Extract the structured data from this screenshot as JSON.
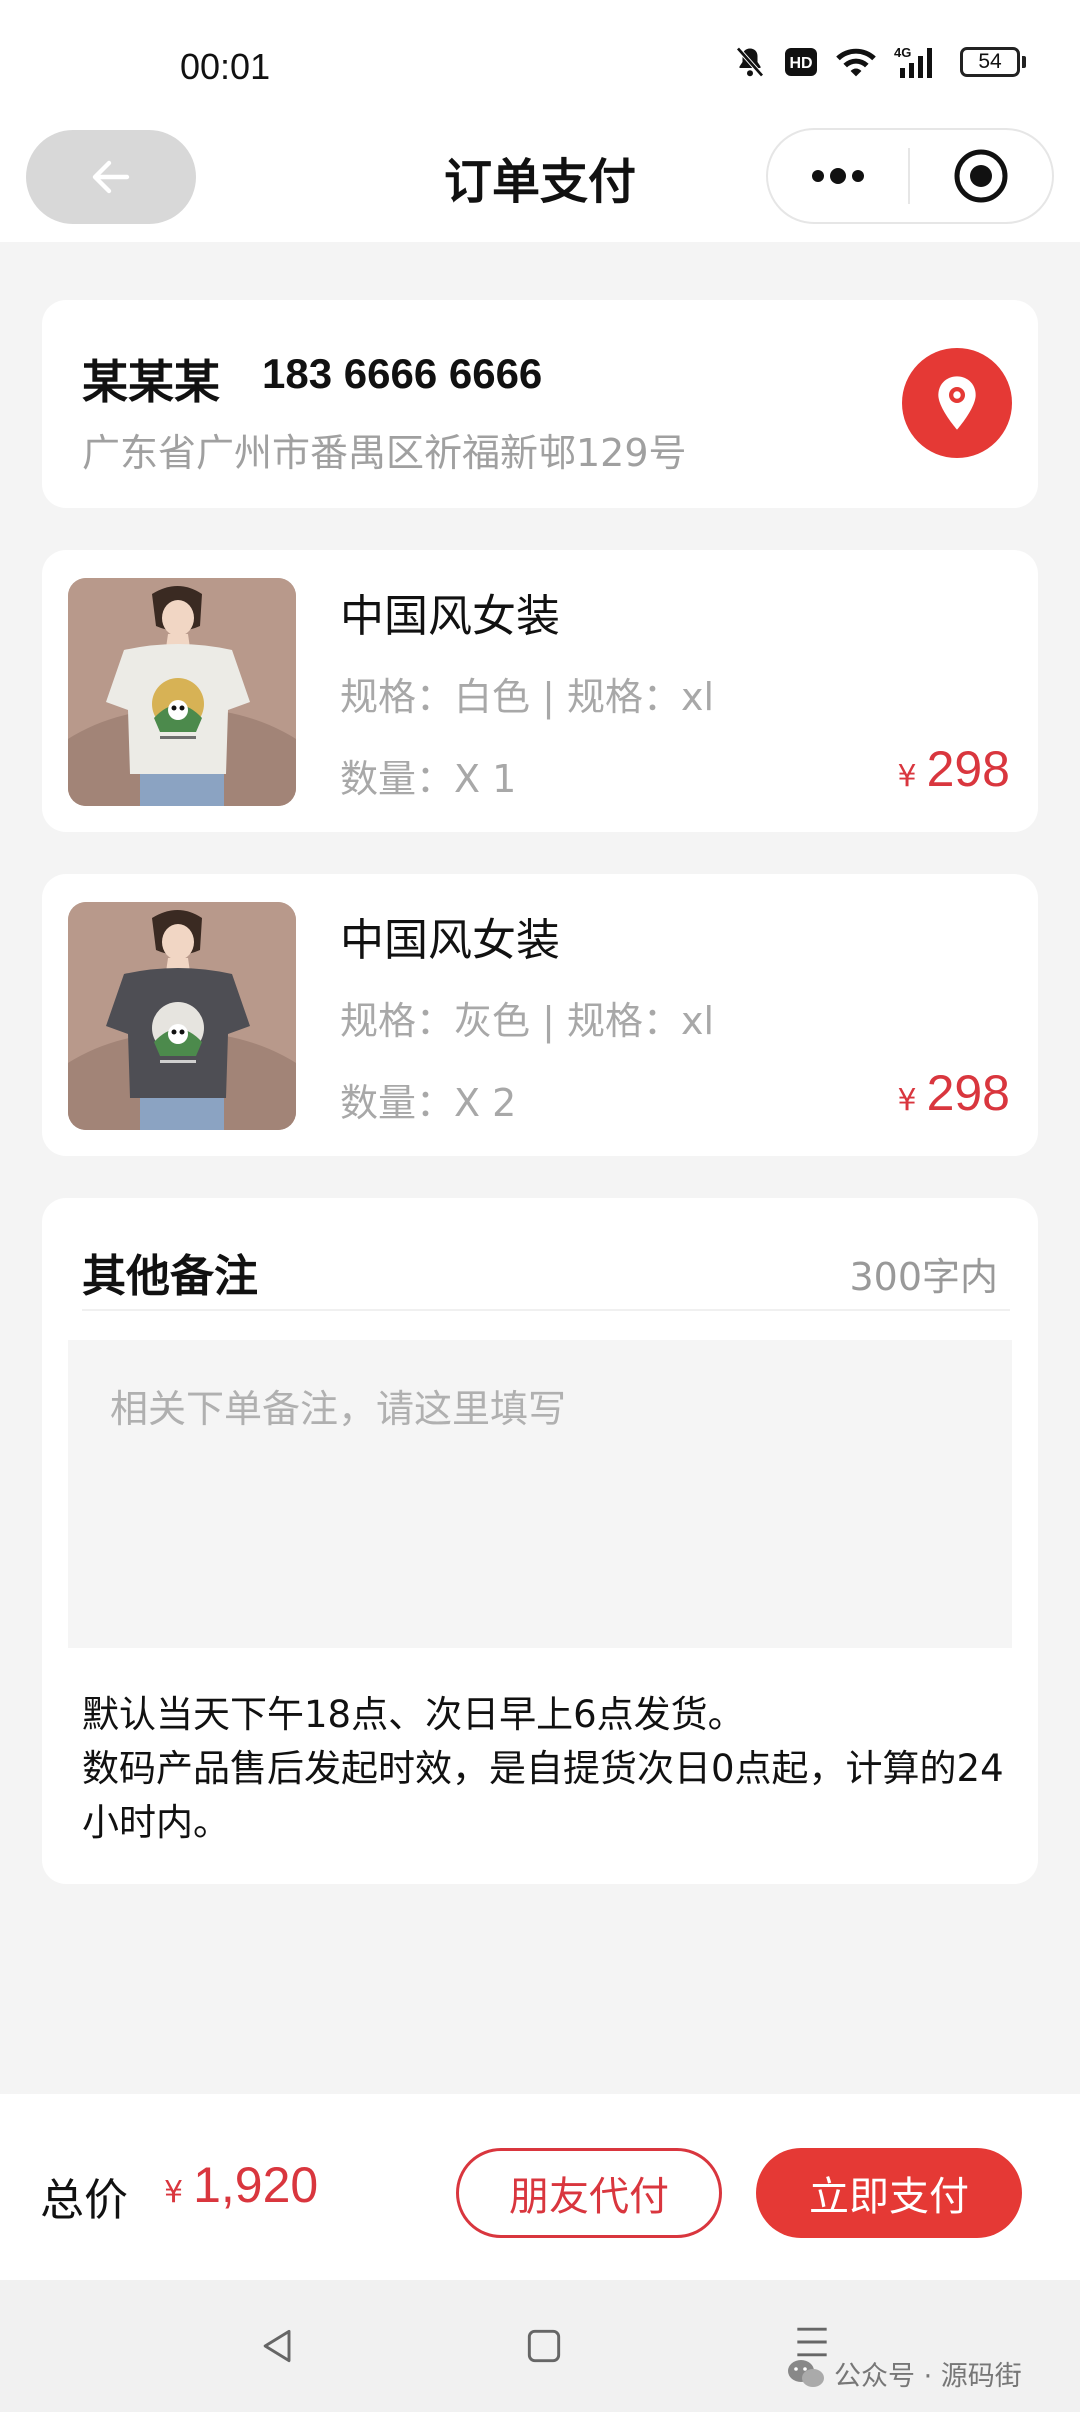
{
  "status_bar": {
    "time": "00:01",
    "network": "4G",
    "hd": "HD",
    "battery": "54"
  },
  "navbar": {
    "title": "订单支付"
  },
  "address": {
    "name": "某某某",
    "phone": "183 6666 6666",
    "detail": "广东省广州市番禺区祈福新邨129号"
  },
  "products": [
    {
      "title": "中国风女装",
      "spec": "规格：白色 | 规格：xl",
      "qty": "数量：X 1",
      "currency": "¥",
      "price": "298",
      "shirt_color": "#ecebe6"
    },
    {
      "title": "中国风女装",
      "spec": "规格：灰色 | 规格：xl",
      "qty": "数量：X 2",
      "currency": "¥",
      "price": "298",
      "shirt_color": "#4e4e54"
    }
  ],
  "remark": {
    "title": "其他备注",
    "limit": "300字内",
    "placeholder": "相关下单备注，请这里填写",
    "value": "",
    "notice_line1": "默认当天下午18点、次日早上6点发货。",
    "notice_line2": "数码产品售后发起时效，是自提货次日0点起，计算的24小时内。"
  },
  "footer": {
    "total_label": "总价",
    "currency": "¥",
    "total": "1,920",
    "friend_pay_label": "朋友代付",
    "pay_now_label": "立即支付"
  },
  "watermark": {
    "text": "公众号 · 源码街"
  },
  "colors": {
    "accent": "#e53935",
    "price": "#d9363e"
  }
}
